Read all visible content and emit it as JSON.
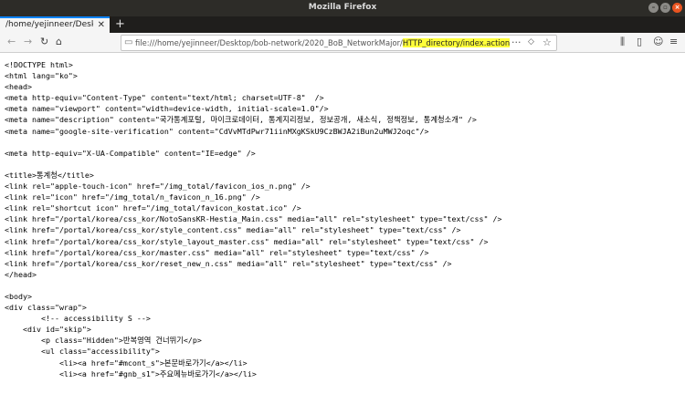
{
  "window": {
    "title": "Mozilla Firefox"
  },
  "tab": {
    "title": "/home/yejinneer/Desktop/b",
    "close_glyph": "✕"
  },
  "toolbar": {
    "newtab_glyph": "+",
    "back_icon": "←",
    "forward_icon": "→",
    "reload_icon": "↻",
    "home_icon": "⌂"
  },
  "urlbar": {
    "url_prefix": "file:///home/yejinneer/Desktop/bob-network/2020_BoB_NetworkMajor/",
    "url_highlighted": "HTTP_directory/index.action",
    "highlight_color": "#ffff3a",
    "more_icon": "···",
    "pocket_icon": "◇",
    "star_icon": "☆"
  },
  "right_toolbar": {
    "library_icon": "⫼",
    "sidebar_icon": "▯",
    "sync_icon": "☺",
    "menu_icon": "≡"
  },
  "source_lines": [
    "<!DOCTYPE html>",
    "<html lang=\"ko\">",
    "<head>",
    "<meta http-equiv=\"Content-Type\" content=\"text/html; charset=UTF-8\"  />",
    "<meta name=\"viewport\" content=\"width=device-width, initial-scale=1.0\"/>",
    "<meta name=\"description\" content=\"국가통계포털, 마이크로데이터, 통계지리정보, 정보공개, 새소식, 정책정보, 통계청소개\" />",
    "<meta name=\"google-site-verification\" content=\"CdVvMTdPwr71iinMXgKSkU9CzBWJA2iBun2uMWJ2oqc\"/>",
    "",
    "<meta http-equiv=\"X-UA-Compatible\" content=\"IE=edge\" />",
    "",
    "<title>통계청</title>",
    "<link rel=\"apple-touch-icon\" href=\"/img_total/favicon_ios_n.png\" />",
    "<link rel=\"icon\" href=\"/img_total/n_favicon_n_16.png\" />",
    "<link rel=\"shortcut icon\" href=\"/img_total/favicon_kostat.ico\" />",
    "<link href=\"/portal/korea/css_kor/NotoSansKR-Hestia_Main.css\" media=\"all\" rel=\"stylesheet\" type=\"text/css\" />",
    "<link href=\"/portal/korea/css_kor/style_content.css\" media=\"all\" rel=\"stylesheet\" type=\"text/css\" />",
    "<link href=\"/portal/korea/css_kor/style_layout_master.css\" media=\"all\" rel=\"stylesheet\" type=\"text/css\" />",
    "<link href=\"/portal/korea/css_kor/master.css\" media=\"all\" rel=\"stylesheet\" type=\"text/css\" />",
    "<link href=\"/portal/korea/css_kor/reset_new_n.css\" media=\"all\" rel=\"stylesheet\" type=\"text/css\" />",
    "</head>",
    "",
    "<body>",
    "<div class=\"wrap\">",
    "        <!-- accessibility S -->",
    "    <div id=\"skip\">",
    "        <p class=\"Hidden\">반복영역 건너뛰기</p>",
    "        <ul class=\"accessibility\">",
    "            <li><a href=\"#mcont_s\">본문바로가기</a></li>",
    "            <li><a href=\"#gnb_s1\">주요메뉴바로가기</a></li>"
  ]
}
